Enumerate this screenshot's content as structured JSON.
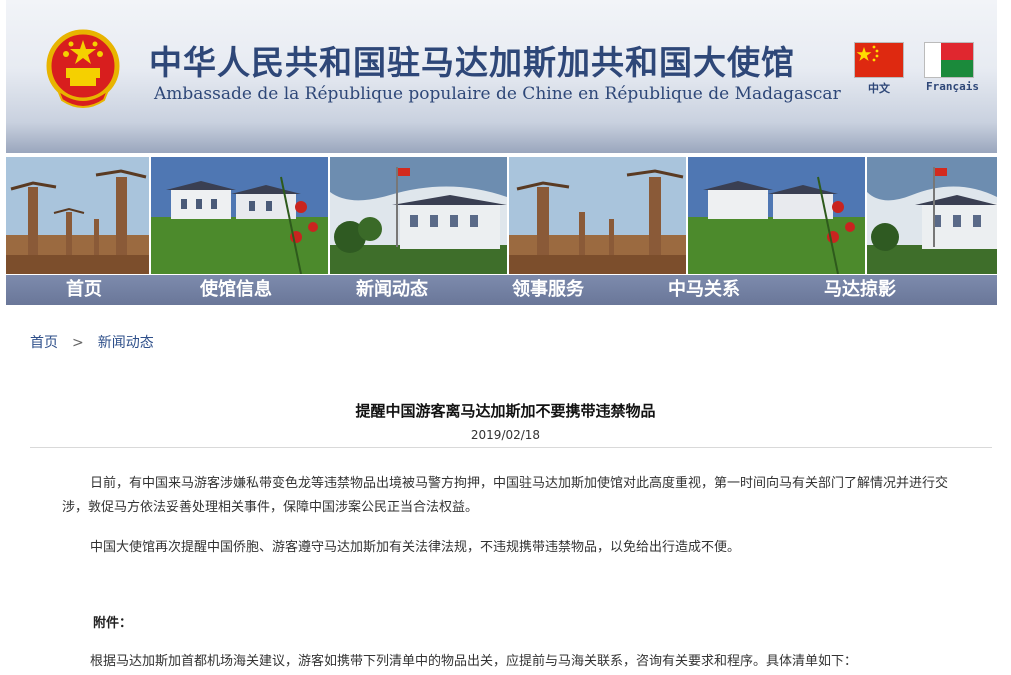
{
  "header": {
    "title_cn": "中华人民共和国驻马达加斯加共和国大使馆",
    "title_fr": "Ambassade de la République populaire de Chine en République de Madagascar",
    "languages": [
      {
        "label": "中文",
        "flag": "china-flag"
      },
      {
        "label": "Français",
        "flag": "madagascar-flag"
      }
    ]
  },
  "colors": {
    "brand": "#2e4778",
    "nav_bg": "#7483a5",
    "link": "#2e4f8a"
  },
  "nav": {
    "items": [
      "首页",
      "使馆信息",
      "新闻动态",
      "领事服务",
      "中马关系",
      "马达掠影"
    ]
  },
  "breadcrumb": {
    "home": "首页",
    "separator": ">",
    "current": "新闻动态"
  },
  "article": {
    "title": "提醒中国游客离马达加斯加不要携带违禁物品",
    "date": "2019/02/18",
    "paragraphs": [
      "日前，有中国来马游客涉嫌私带变色龙等违禁物品出境被马警方拘押，中国驻马达加斯加使馆对此高度重视，第一时间向马有关部门了解情况并进行交涉，敦促马方依法妥善处理相关事件，保障中国涉案公民正当合法权益。",
      "中国大使馆再次提醒中国侨胞、游客遵守马达加斯加有关法律法规，不违规携带违禁物品，以免给出行造成不便。"
    ],
    "attachment_label": "附件：",
    "attachment_text": "根据马达加斯加首都机场海关建议，游客如携带下列清单中的物品出关，应提前与马海关联系，咨询有关要求和程序。具体清单如下："
  }
}
